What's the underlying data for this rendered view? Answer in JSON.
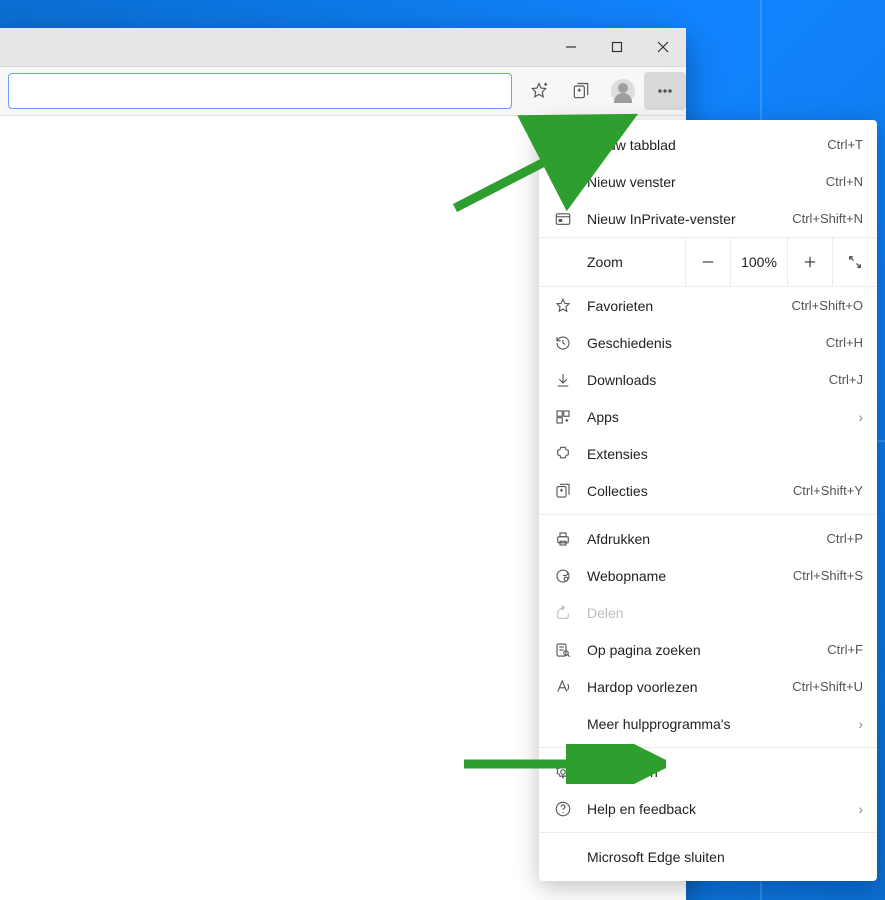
{
  "window_controls": {
    "minimize": "−",
    "maximize": "☐",
    "close": "✕"
  },
  "toolbar_icons": {
    "favorites": "favorites-star-icon",
    "collections": "collections-icon",
    "profile": "profile-avatar-icon",
    "more": "more-dots-icon"
  },
  "menu": {
    "new_tab": {
      "label": "Nieuw tabblad",
      "shortcut": "Ctrl+T"
    },
    "new_window": {
      "label": "Nieuw venster",
      "shortcut": "Ctrl+N"
    },
    "new_inprivate": {
      "label": "Nieuw InPrivate-venster",
      "shortcut": "Ctrl+Shift+N"
    },
    "zoom": {
      "label": "Zoom",
      "value": "100%"
    },
    "favorites": {
      "label": "Favorieten",
      "shortcut": "Ctrl+Shift+O"
    },
    "history": {
      "label": "Geschiedenis",
      "shortcut": "Ctrl+H"
    },
    "downloads": {
      "label": "Downloads",
      "shortcut": "Ctrl+J"
    },
    "apps": {
      "label": "Apps"
    },
    "extensions": {
      "label": "Extensies"
    },
    "collections": {
      "label": "Collecties",
      "shortcut": "Ctrl+Shift+Y"
    },
    "print": {
      "label": "Afdrukken",
      "shortcut": "Ctrl+P"
    },
    "web_capture": {
      "label": "Webopname",
      "shortcut": "Ctrl+Shift+S"
    },
    "share": {
      "label": "Delen"
    },
    "find": {
      "label": "Op pagina zoeken",
      "shortcut": "Ctrl+F"
    },
    "read_aloud": {
      "label": "Hardop voorlezen",
      "shortcut": "Ctrl+Shift+U"
    },
    "more_tools": {
      "label": "Meer hulpprogramma's"
    },
    "settings": {
      "label": "Instellingen"
    },
    "help": {
      "label": "Help en feedback"
    },
    "exit": {
      "label": "Microsoft Edge sluiten"
    }
  }
}
